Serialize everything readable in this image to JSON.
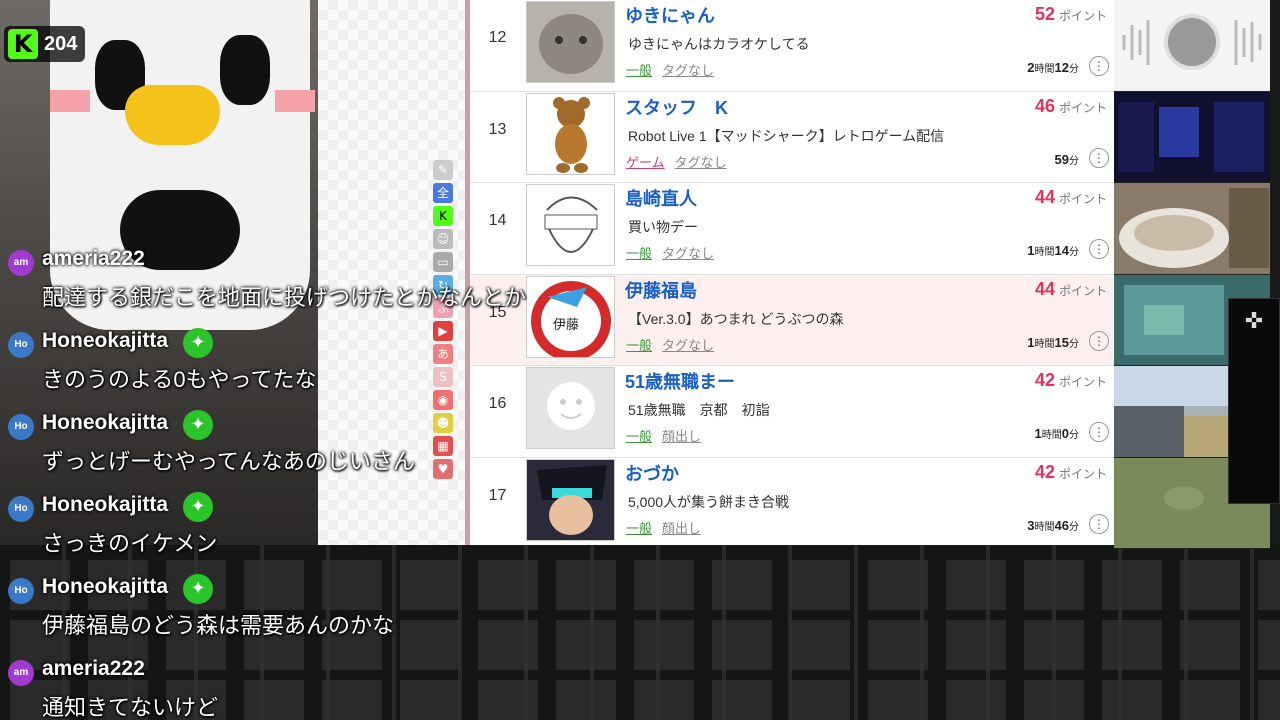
{
  "stream": {
    "platform_icon": "kick-k-icon",
    "viewer_count": "204"
  },
  "ranking": {
    "points_unit": "ポイント",
    "rows": [
      {
        "rank": "12",
        "name": "ゆきにゃん",
        "points": "52",
        "title": "ゆきにゃんはカラオケしてる",
        "category": "一般",
        "tag": "タグなし",
        "duration_h": "2",
        "duration_m": "12",
        "thumb": "cat-photo"
      },
      {
        "rank": "13",
        "name": "スタッフ　K",
        "points": "46",
        "title": "Robot Live 1【マッドシャーク】レトロゲーム配信",
        "category": "ゲーム",
        "tag": "タグなし",
        "duration_h": "",
        "duration_m": "59",
        "thumb": "teddy-bear"
      },
      {
        "rank": "14",
        "name": "島崎直人",
        "points": "44",
        "title": "買い物デー",
        "category": "一般",
        "tag": "タグなし",
        "duration_h": "1",
        "duration_m": "14",
        "thumb": "sketch-face"
      },
      {
        "rank": "15",
        "name": "伊藤福島",
        "points": "44",
        "title": "【Ver.3.0】あつまれ どうぶつの森",
        "category": "一般",
        "tag": "タグなし",
        "duration_h": "1",
        "duration_m": "15",
        "thumb": "ito-logo",
        "avatar_text": "伊藤"
      },
      {
        "rank": "16",
        "name": "51歳無職まー",
        "points": "42",
        "title": "51歳無職　京都　初詣",
        "category": "一般",
        "tag": "顔出し",
        "duration_h": "1",
        "duration_m": "0",
        "thumb": "default-avatar"
      },
      {
        "rank": "17",
        "name": "おづか",
        "points": "42",
        "title": "5,000人が集う餅まき合戦",
        "category": "一般",
        "tag": "顔出し",
        "duration_h": "3",
        "duration_m": "46",
        "thumb": "anime-character"
      }
    ],
    "hour_unit": "時間",
    "minute_unit": "分"
  },
  "chat": [
    {
      "initials": "am",
      "user": "ameria222",
      "message": "配達する銀だこを地面に投げつけたとかなんとか",
      "verified": false
    },
    {
      "initials": "Ho",
      "user": "Honeokajitta",
      "message": "きのうのよる0もやってたな",
      "verified": true
    },
    {
      "initials": "Ho",
      "user": "Honeokajitta",
      "message": "ずっとげーむやってんなあのじいさん",
      "verified": true
    },
    {
      "initials": "Ho",
      "user": "Honeokajitta",
      "message": "さっきのイケメン",
      "verified": true
    },
    {
      "initials": "Ho",
      "user": "Honeokajitta",
      "message": "伊藤福島のどう森は需要あんのかな",
      "verified": true
    },
    {
      "initials": "am",
      "user": "ameria222",
      "message": "通知きてないけど",
      "verified": false
    }
  ],
  "colors": {
    "accent_green": "#53fc18",
    "points_pink": "#e4325a",
    "name_blue": "#1a5fc8",
    "highlight_row": "#fff0f0"
  },
  "side_toolbar_label": "全"
}
